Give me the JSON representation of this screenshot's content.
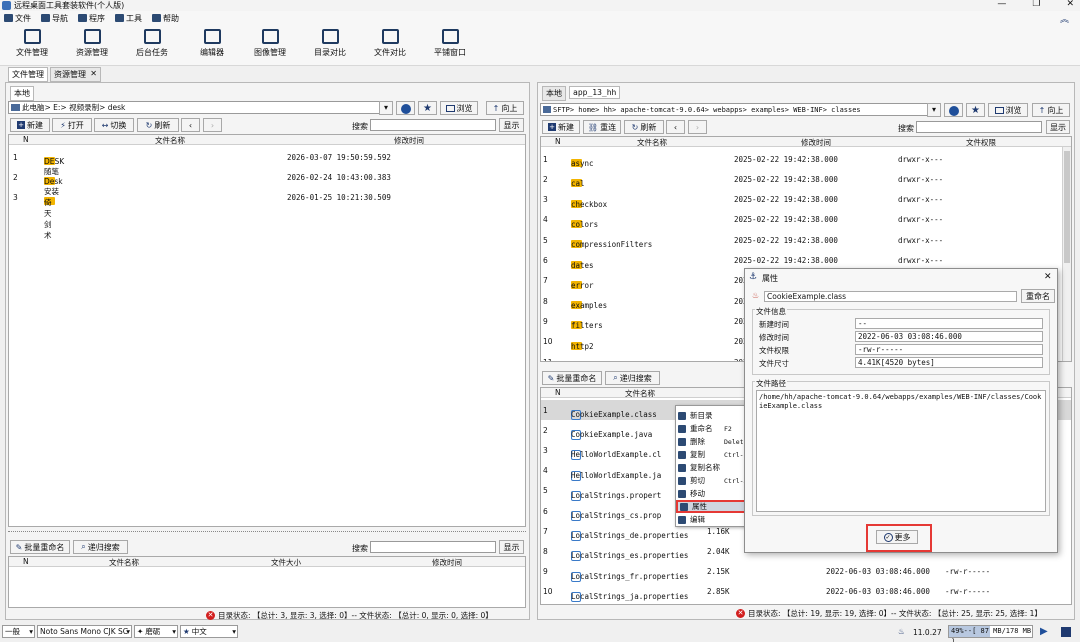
{
  "app": {
    "title": "远程桌面工具套装软件(个人版)"
  },
  "menu": [
    {
      "label": "文件",
      "icon": "file-icon"
    },
    {
      "label": "导航",
      "icon": "nav-icon"
    },
    {
      "label": "程序",
      "icon": "program-icon"
    },
    {
      "label": "工具",
      "icon": "tools-icon"
    },
    {
      "label": "帮助",
      "icon": "help-icon"
    }
  ],
  "toolbar": [
    "文件管理",
    "资源管理",
    "后台任务",
    "编辑器",
    "图像管理",
    "目录对比",
    "文件对比",
    "平铺窗口"
  ],
  "main_tabs": [
    "文件管理",
    "资源管理"
  ],
  "left": {
    "tab": "本地",
    "path": "此电脑> E:> 视频录制> desk",
    "browse": "浏览",
    "up": "向上",
    "actions": {
      "new": "新建",
      "open": "打开",
      "switch": "切换",
      "refresh": "刷新"
    },
    "search_label": "搜索",
    "show": "显示",
    "columns": {
      "n": "N",
      "name": "文件名称",
      "mtime": "修改时间"
    },
    "rows": [
      {
        "n": "1",
        "name": "DESK随笔",
        "mtime": "2026-03-07 19:50:59.592"
      },
      {
        "n": "2",
        "name": "Desk安装",
        "mtime": "2026-02-24 10:43:00.383"
      },
      {
        "n": "3",
        "name": "倚天剑术",
        "mtime": "2026-01-25 10:21:30.509"
      }
    ],
    "batch": {
      "rename": "批量重命名",
      "search": "递归搜索",
      "search_label": "搜索",
      "show": "显示"
    },
    "batch_columns": {
      "n": "N",
      "name": "文件名称",
      "size": "文件大小",
      "mtime": "修改时间"
    },
    "status": "目录状态: 【总计: 3, 显示: 3, 选择: 0】-- 文件状态: 【总计: 0, 显示: 0, 选择: 0】"
  },
  "right": {
    "tabs": [
      "本地",
      "app_13_hh"
    ],
    "path": "SFTP> home> hh> apache-tomcat-9.0.64> webapps> examples> WEB-INF> classes",
    "browse": "浏览",
    "up": "向上",
    "actions": {
      "new": "新建",
      "reconnect": "重连",
      "refresh": "刷新"
    },
    "search_label": "搜索",
    "show": "显示",
    "columns": {
      "n": "N",
      "name": "文件名称",
      "mtime": "修改时间",
      "perm": "文件权限"
    },
    "rows": [
      {
        "n": "1",
        "name": "async",
        "mtime": "2025-02-22 19:42:38.000",
        "perm": "drwxr-x---"
      },
      {
        "n": "2",
        "name": "cal",
        "mtime": "2025-02-22 19:42:38.000",
        "perm": "drwxr-x---"
      },
      {
        "n": "3",
        "name": "checkbox",
        "mtime": "2025-02-22 19:42:38.000",
        "perm": "drwxr-x---"
      },
      {
        "n": "4",
        "name": "colors",
        "mtime": "2025-02-22 19:42:38.000",
        "perm": "drwxr-x---"
      },
      {
        "n": "5",
        "name": "compressionFilters",
        "mtime": "2025-02-22 19:42:38.000",
        "perm": "drwxr-x---"
      },
      {
        "n": "6",
        "name": "dates",
        "mtime": "2025-02-22 19:42:38.000",
        "perm": "drwxr-x---"
      },
      {
        "n": "7",
        "name": "error",
        "mtime": "202",
        "perm": ""
      },
      {
        "n": "8",
        "name": "examples",
        "mtime": "202",
        "perm": ""
      },
      {
        "n": "9",
        "name": "filters",
        "mtime": "202",
        "perm": ""
      },
      {
        "n": "10",
        "name": "http2",
        "mtime": "202",
        "perm": ""
      },
      {
        "n": "11",
        "name": "jsp2",
        "mtime": "202",
        "perm": ""
      }
    ],
    "batch": {
      "rename": "批量重命名",
      "search": "递归搜索"
    },
    "batch_columns": {
      "n": "N",
      "name": "文件名称"
    },
    "files": [
      {
        "n": "1",
        "name": "CookieExample.class",
        "size": "",
        "mtime": "",
        "perm": ""
      },
      {
        "n": "2",
        "name": "CookieExample.java",
        "size": "",
        "mtime": "",
        "perm": ""
      },
      {
        "n": "3",
        "name": "HelloWorldExample.cl",
        "size": "",
        "mtime": "",
        "perm": ""
      },
      {
        "n": "4",
        "name": "HelloWorldExample.ja",
        "size": "",
        "mtime": "",
        "perm": ""
      },
      {
        "n": "5",
        "name": "LocalStrings.propert",
        "size": "",
        "mtime": "",
        "perm": ""
      },
      {
        "n": "6",
        "name": "LocalStrings_cs.prop",
        "size": "",
        "mtime": "",
        "perm": ""
      },
      {
        "n": "7",
        "name": "LocalStrings_de.properties",
        "size": "1.16K",
        "mtime": "",
        "perm": ""
      },
      {
        "n": "8",
        "name": "LocalStrings_es.properties",
        "size": "2.04K",
        "mtime": "",
        "perm": ""
      },
      {
        "n": "9",
        "name": "LocalStrings_fr.properties",
        "size": "2.15K",
        "mtime": "2022-06-03 03:08:46.000",
        "perm": "-rw-r-----"
      },
      {
        "n": "10",
        "name": "LocalStrings_ja.properties",
        "size": "2.85K",
        "mtime": "2022-06-03 03:08:46.000",
        "perm": "-rw-r-----"
      }
    ],
    "status": "目录状态: 【总计: 19, 显示: 19, 选择: 0】-- 文件状态: 【总计: 25, 显示: 25, 选择: 1】"
  },
  "context_menu": [
    {
      "label": "新目录",
      "shortcut": "",
      "icon": "new-folder-icon"
    },
    {
      "label": "重命名",
      "shortcut": "F2",
      "icon": "rename-icon"
    },
    {
      "label": "删除",
      "shortcut": "Delete",
      "icon": "delete-icon"
    },
    {
      "label": "复制",
      "shortcut": "Ctrl-C",
      "icon": "copy-icon"
    },
    {
      "label": "复制名称",
      "shortcut": "",
      "icon": "copy-name-icon"
    },
    {
      "label": "剪切",
      "shortcut": "Ctrl-X",
      "icon": "cut-icon"
    },
    {
      "label": "移动",
      "shortcut": "",
      "icon": "move-icon"
    },
    {
      "label": "属性",
      "shortcut": "",
      "icon": "properties-icon"
    },
    {
      "label": "编辑",
      "shortcut": "",
      "icon": "edit-icon"
    }
  ],
  "dialog": {
    "title": "属性",
    "filename": "CookieExample.class",
    "rename": "重命名",
    "info_title": "文件信息",
    "fields": [
      {
        "label": "新建时间",
        "value": "--"
      },
      {
        "label": "修改时间",
        "value": "2022-06-03 03:08:46.000"
      },
      {
        "label": "文件权限",
        "value": "-rw-r-----"
      },
      {
        "label": "文件尺寸",
        "value": "4.41K[4520 bytes]"
      }
    ],
    "path_title": "文件路径",
    "path": "/home/hh/apache-tomcat-9.0.64/webapps/examples/WEB-INF/classes/CookieExample.class",
    "more": "更多"
  },
  "bottom": {
    "mode": "一般",
    "font": "Noto Sans Mono CJK SC",
    "theme": "磨砺",
    "lang": "中文",
    "version": "11.0.27",
    "memory": "49%--[ 87 MB/178 MB ]"
  }
}
